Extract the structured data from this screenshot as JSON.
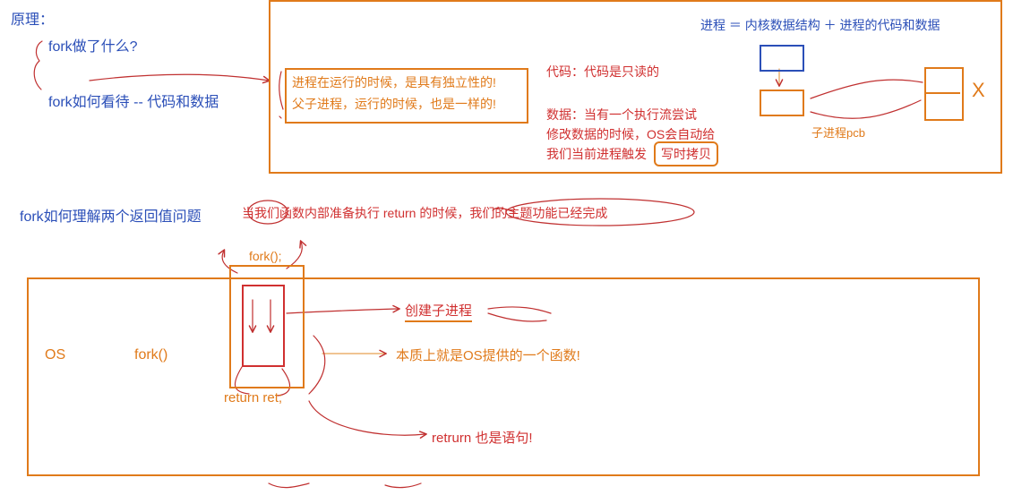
{
  "title": {
    "principle": "原理：",
    "q1": "fork做了什么?",
    "q2": "fork如何看待 -- 代码和数据",
    "q3": "fork如何理解两个返回值问题"
  },
  "top_right": {
    "equation": "进程 ＝ 内核数据结构 ＋ 进程的代码和数据",
    "box_line1": "进程在运行的时候，是具有独立性的!",
    "box_line2": "父子进程，运行的时候，也是一样的!",
    "code_note": "代码：代码是只读的",
    "data_note1": "数据：当有一个执行流尝试",
    "data_note2": "修改数据的时候，OS会自动给",
    "data_note3": "我们当前进程触发",
    "cow_label": "写时拷贝",
    "child_pcb_label": "子进程pcb",
    "x_mark": "X"
  },
  "mid_sentence": {
    "part1": "当我们函数内部准备执行 return 的时候，我们的主题功能已经完成"
  },
  "bottom": {
    "os_label": "OS",
    "fork_label": "fork()",
    "fork_call": "fork();",
    "create_child": "创建子进程",
    "essence": "本质上就是OS提供的一个函数!",
    "return_stmt": "return ret;",
    "return_is_stmt": "retrurn 也是语句!"
  }
}
